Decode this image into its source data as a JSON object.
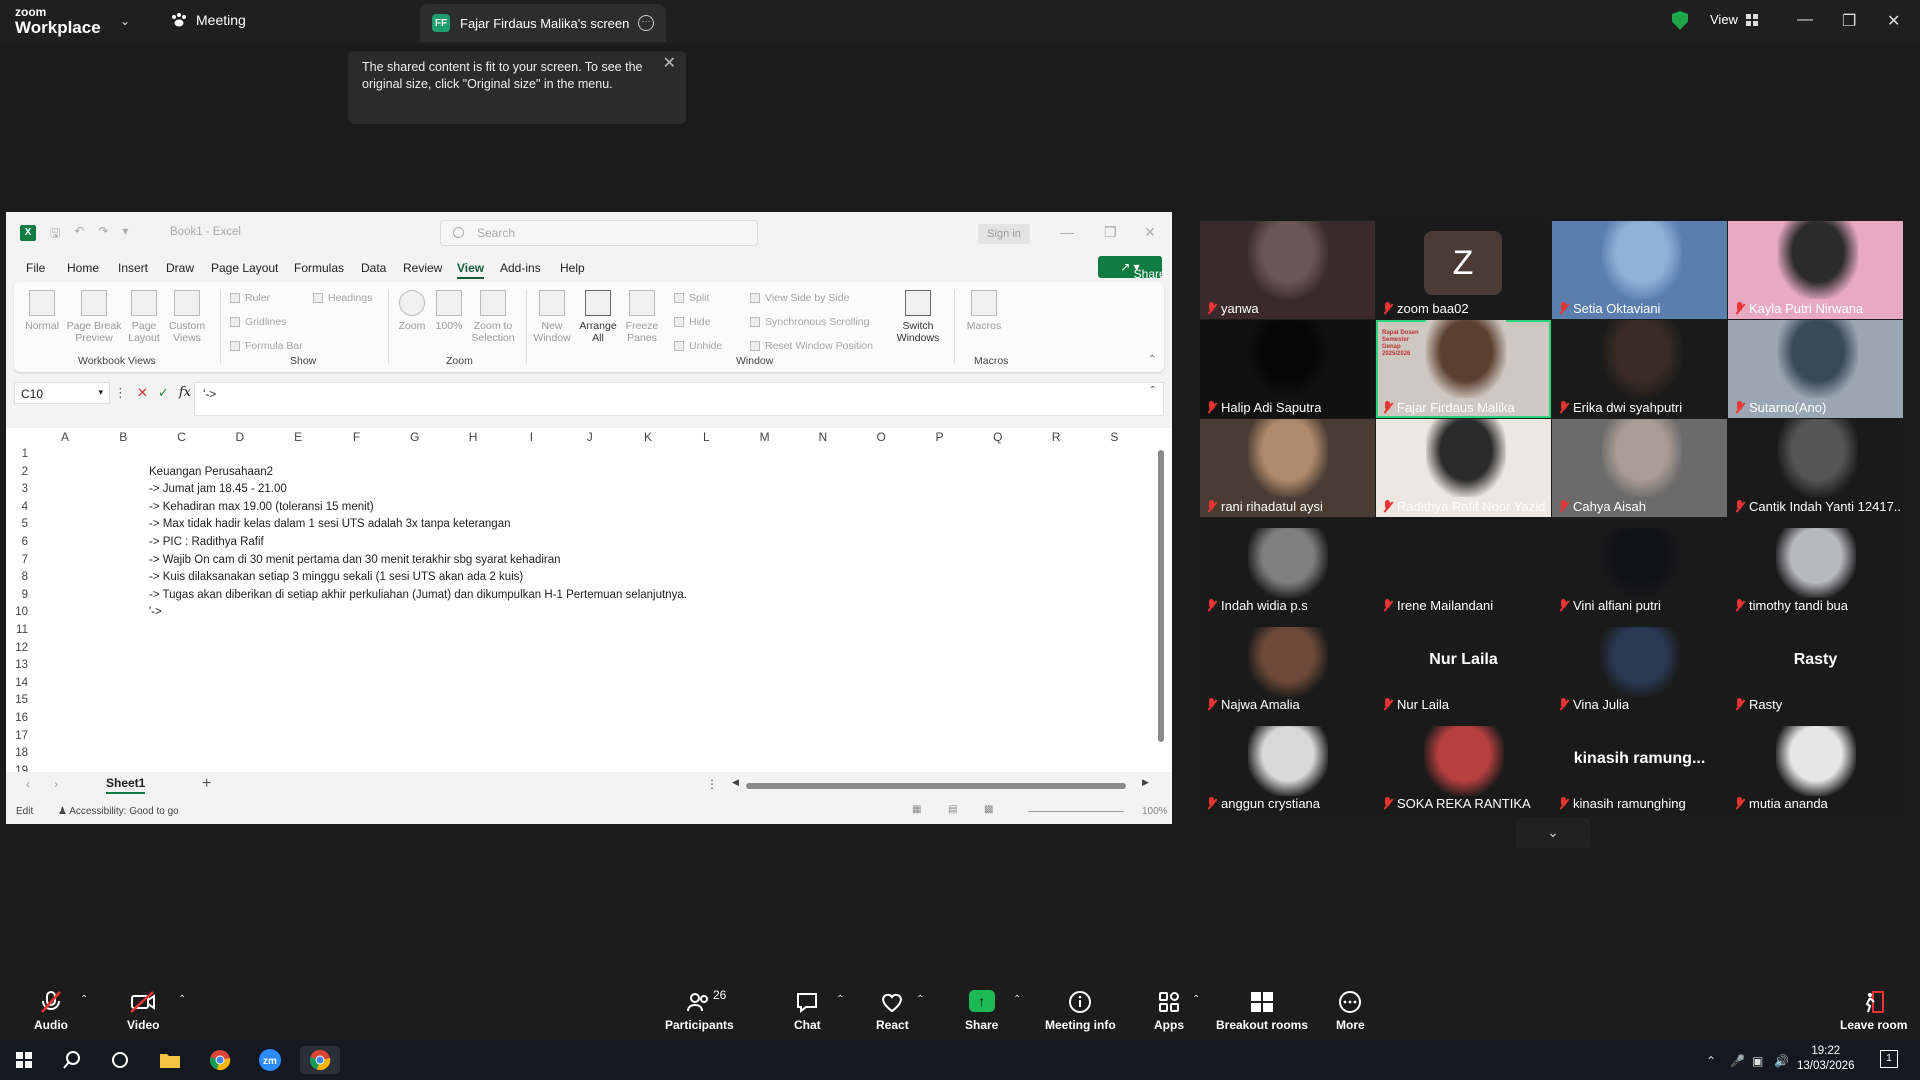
{
  "topbar": {
    "logo_line1": "zoom",
    "logo_line2": "Workplace",
    "meeting_label": "Meeting",
    "share_avatar": "FF",
    "share_title": "Fajar Firdaus Malika's screen",
    "view_label": "View"
  },
  "tooltip": {
    "text": "The shared content is fit to your screen. To see the original size, click \"Original size\" in the menu."
  },
  "excel": {
    "book_title": "Book1  -  Excel",
    "search_placeholder": "Search",
    "sign_in": "Sign in",
    "menu": [
      "File",
      "Home",
      "Insert",
      "Draw",
      "Page Layout",
      "Formulas",
      "Data",
      "Review",
      "View",
      "Add-ins",
      "Help"
    ],
    "share_label": "Share",
    "ribbon": {
      "workbook_views": [
        "Normal",
        "Page Break Preview",
        "Page Layout",
        "Custom Views"
      ],
      "show": [
        "Ruler",
        "Headings",
        "Gridlines",
        "Formula Bar"
      ],
      "zoom": [
        "Zoom",
        "100%",
        "Zoom to Selection"
      ],
      "window_big": [
        "New Window",
        "Arrange All",
        "Freeze Panes"
      ],
      "window_small": [
        "Split",
        "Hide",
        "Unhide",
        "View Side by Side",
        "Synchronous Scrolling",
        "Reset Window Position"
      ],
      "switch_windows": "Switch Windows",
      "macros": "Macros",
      "group_labels": [
        "Workbook Views",
        "Show",
        "Zoom",
        "Window",
        "Macros"
      ]
    },
    "name_box": "C10",
    "formula": "'->",
    "columns": [
      "A",
      "B",
      "C",
      "D",
      "E",
      "F",
      "G",
      "H",
      "I",
      "J",
      "K",
      "L",
      "M",
      "N",
      "O",
      "P",
      "Q",
      "R",
      "S"
    ],
    "rows": [
      "1",
      "2",
      "3",
      "4",
      "5",
      "6",
      "7",
      "8",
      "9",
      "10",
      "11",
      "12",
      "13",
      "14",
      "15",
      "16",
      "17",
      "18",
      "19"
    ],
    "cells": [
      "",
      "Keuangan Perusahaan2",
      "-> Jumat jam 18.45 - 21.00",
      "-> Kehadiran max 19.00 (toleransi 15 menit)",
      "-> Max tidak hadir kelas dalam 1 sesi UTS adalah 3x tanpa keterangan",
      "-> PIC : Radithya Rafif",
      "-> Wajib On cam di 30 menit pertama dan 30 menit terakhir sbg syarat kehadiran",
      "-> Kuis dilaksanakan setiap 3 minggu sekali (1 sesi UTS akan ada 2 kuis)",
      "-> Tugas akan diberikan di setiap akhir perkuliahan (Jumat) dan dikumpulkan H-1 Pertemuan selanjutnya.",
      "'->"
    ],
    "sheet_tab": "Sheet1",
    "status_mode": "Edit",
    "accessibility": "Accessibility: Good to go",
    "zoom_level": "100%"
  },
  "gallery": {
    "participants": [
      {
        "name": "yanwa"
      },
      {
        "name": "zoom baa02",
        "initial": "Z"
      },
      {
        "name": "Setia Oktaviani"
      },
      {
        "name": "Kayla Putri Nirwana"
      },
      {
        "name": "Halip Adi Saputra"
      },
      {
        "name": "Fajar Firdaus Malika",
        "slide_text": "Rapat Dosen Semester Genap 2025/2026"
      },
      {
        "name": "Erika dwi syahputri"
      },
      {
        "name": "Sutarno(Ano)"
      },
      {
        "name": "rani rihadatul aysi"
      },
      {
        "name": "Radithya Rafif Noor Yazid"
      },
      {
        "name": "Cahya Aisah"
      },
      {
        "name": "Cantik Indah Yanti 12417..."
      },
      {
        "name": "Indah widia p.s"
      },
      {
        "name": "Irene Mailandani"
      },
      {
        "name": "Vini alfiani putri"
      },
      {
        "name": "timothy tandi bua"
      },
      {
        "name": "Najwa Amalia"
      },
      {
        "name": "Nur Laila",
        "big": "Nur Laila"
      },
      {
        "name": "Vina Julia"
      },
      {
        "name": "Rasty",
        "big": "Rasty"
      },
      {
        "name": "anggun crystiana"
      },
      {
        "name": "SOKA REKA RANTIKA"
      },
      {
        "name": "kinasih ramunghing",
        "big": "kinasih  ramung..."
      },
      {
        "name": "mutia ananda"
      }
    ]
  },
  "controls": {
    "audio": "Audio",
    "video": "Video",
    "participants": "Participants",
    "participants_count": "26",
    "chat": "Chat",
    "react": "React",
    "share": "Share",
    "meeting_info": "Meeting info",
    "apps": "Apps",
    "breakout": "Breakout rooms",
    "more": "More",
    "leave": "Leave room"
  },
  "taskbar": {
    "time": "19:22",
    "date": "13/03/2026",
    "notification_count": "1"
  },
  "colors": {
    "zoom_bg": "#1b1b1b",
    "excel_green": "#107c41",
    "share_green": "#1db954",
    "active_speaker": "#2bd37a",
    "mute_red": "#e33333"
  }
}
